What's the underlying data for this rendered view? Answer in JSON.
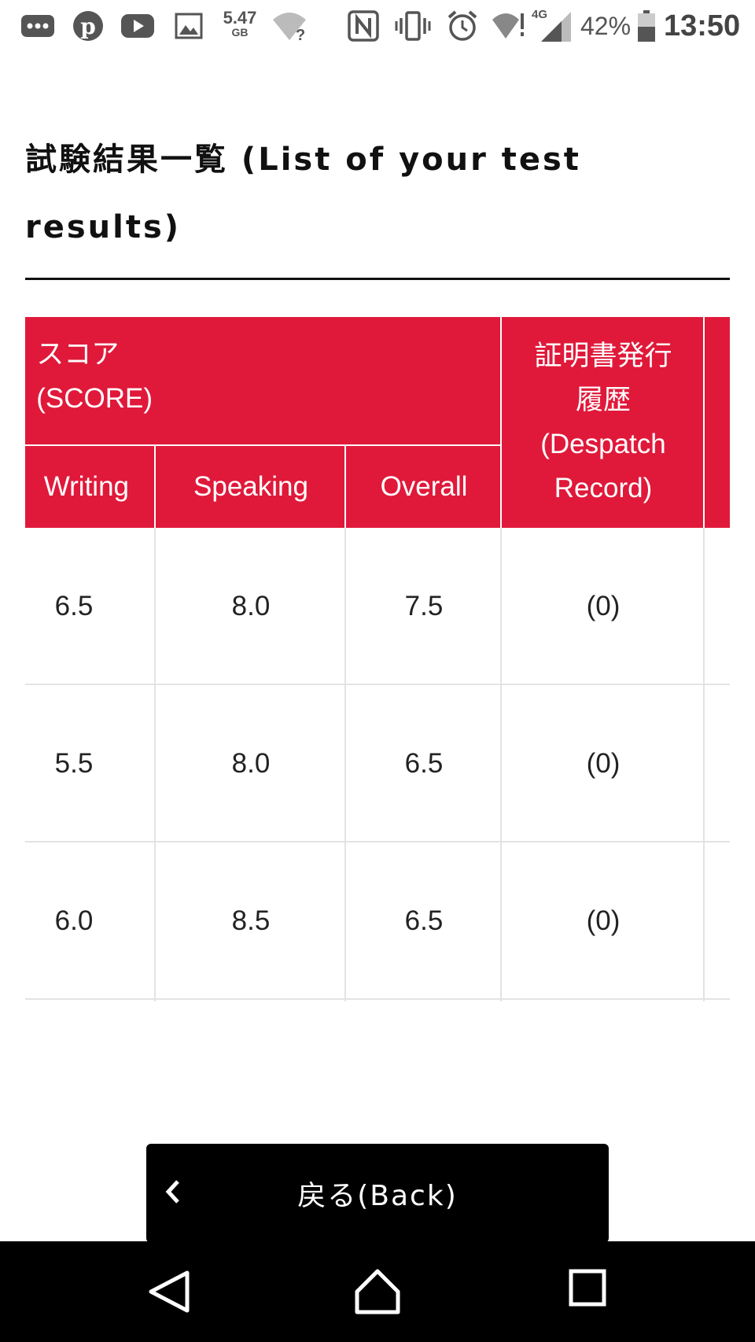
{
  "status_bar": {
    "storage_value": "5.47",
    "storage_unit": "GB",
    "network": "4G",
    "battery": "42%",
    "time": "13:50"
  },
  "page": {
    "title_line1": "試験結果一覧 (List of your test",
    "title_line2": "results)"
  },
  "table": {
    "group_header_jp": "スコア",
    "group_header_en": "(SCORE)",
    "despatch_header_jp_1": "証明書発行",
    "despatch_header_jp_2": "履歴",
    "despatch_header_en_1": "(Despatch",
    "despatch_header_en_2": "Record)",
    "columns": [
      "Writing",
      "Speaking",
      "Overall"
    ],
    "rows": [
      {
        "writing": "6.5",
        "speaking": "8.0",
        "overall": "7.5",
        "despatch": "(0)"
      },
      {
        "writing": "5.5",
        "speaking": "8.0",
        "overall": "6.5",
        "despatch": "(0)"
      },
      {
        "writing": "6.0",
        "speaking": "8.5",
        "overall": "6.5",
        "despatch": "(0)"
      }
    ]
  },
  "back_button": {
    "label": "戻る(Back)"
  },
  "colors": {
    "header_red": "#e0193a",
    "button_black": "#000000"
  }
}
